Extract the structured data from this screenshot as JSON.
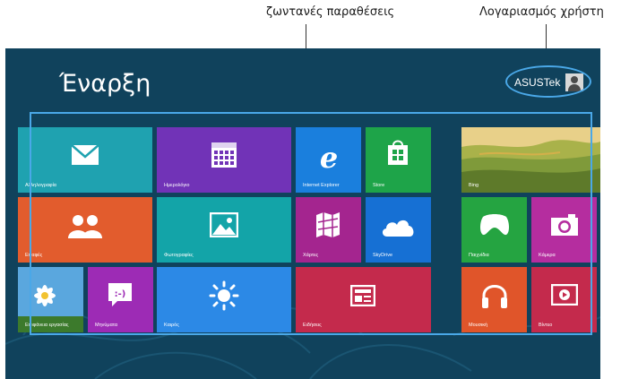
{
  "callouts": {
    "live_tiles": "ζωντανές παραθέσεις",
    "user_account": "Λογαριασμός χρήστη"
  },
  "start": {
    "title": "Έναρξη",
    "user_name": "ASUSTek"
  },
  "tiles": [
    {
      "label": "Αλληλογραφία",
      "color": "#1fa2b0",
      "icon": "mail-icon"
    },
    {
      "label": "Ημερολόγιο",
      "color": "#7133b7",
      "icon": "calendar-icon"
    },
    {
      "label": "Internet Explorer",
      "color": "#1a7fdd",
      "icon": "internet-explorer-icon"
    },
    {
      "label": "Store",
      "color": "#1ea449",
      "icon": "store-icon"
    },
    {
      "label": "Bing",
      "color": "#8a8a3a",
      "icon": "bing-landscape-image"
    },
    {
      "label": "Επαφές",
      "color": "#e25c2d",
      "icon": "people-icon"
    },
    {
      "label": "Φωτογραφίες",
      "color": "#13a4a8",
      "icon": "photos-icon"
    },
    {
      "label": "Χάρτες",
      "color": "#a4258f",
      "icon": "maps-icon"
    },
    {
      "label": "SkyDrive",
      "color": "#1670d4",
      "icon": "skydrive-cloud-icon"
    },
    {
      "label": "Παιχνίδια",
      "color": "#25a441",
      "icon": "games-controller-icon"
    },
    {
      "label": "Κάμερα",
      "color": "#b52d9f",
      "icon": "camera-icon"
    },
    {
      "label": "Επιφάνεια εργασίας",
      "color": "#3a8fd0",
      "icon": "desktop-daisy-image"
    },
    {
      "label": "Μηνύματα",
      "color": "#9d2bb5",
      "icon": "messaging-icon"
    },
    {
      "label": "Καιρός",
      "color": "#2c89e6",
      "icon": "weather-sun-icon"
    },
    {
      "label": "Ειδήσεις",
      "color": "#c42a4c",
      "icon": "news-icon"
    },
    {
      "label": "Μουσική",
      "color": "#e0552a",
      "icon": "music-headphones-icon"
    },
    {
      "label": "Βίντεο",
      "color": "#c42a4c",
      "icon": "video-icon"
    }
  ]
}
